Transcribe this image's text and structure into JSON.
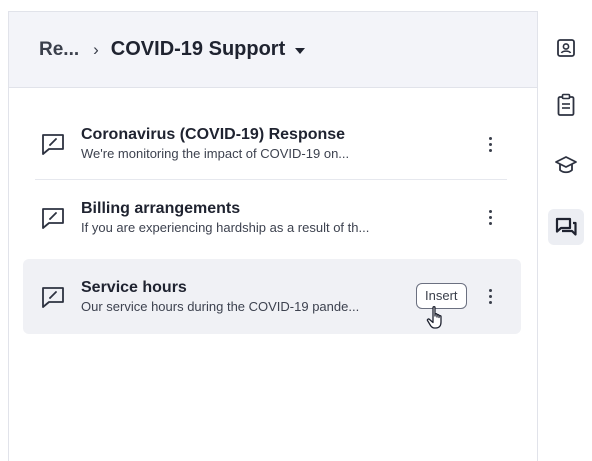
{
  "breadcrumb": {
    "parent": "Re...",
    "separator": "›",
    "current": "COVID-19 Support"
  },
  "articles": [
    {
      "title": "Coronavirus (COVID-19) Response",
      "description": "We're monitoring the impact of COVID-19 on..."
    },
    {
      "title": "Billing arrangements",
      "description": "If you are experiencing hardship as a result of th..."
    },
    {
      "title": "Service hours",
      "description": "Our service hours during the COVID-19 pande...",
      "action_label": "Insert"
    }
  ],
  "rail": {
    "items": [
      {
        "icon": "contact-card-icon"
      },
      {
        "icon": "clipboard-icon"
      },
      {
        "icon": "graduation-cap-icon"
      },
      {
        "icon": "chat-bubbles-icon",
        "active": true
      }
    ]
  },
  "colors": {
    "header_bg": "#f3f4f9",
    "active_row_bg": "#f0f1f5",
    "text": "#1f2330"
  }
}
